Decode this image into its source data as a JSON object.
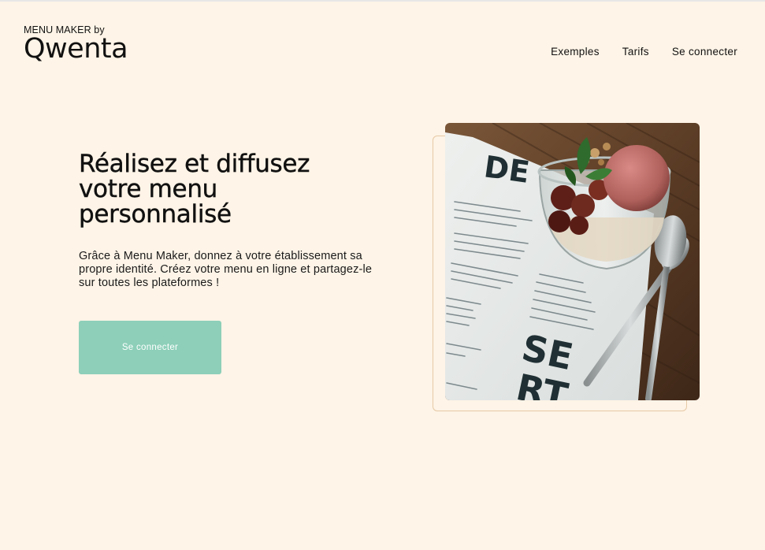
{
  "brand": {
    "tagline": "MENU MAKER by",
    "name": "Qwenta"
  },
  "nav": {
    "items": [
      {
        "label": "Exemples"
      },
      {
        "label": "Tarifs"
      },
      {
        "label": "Se connecter"
      }
    ]
  },
  "hero": {
    "title": "Réalisez et diffusez votre menu personnalisé",
    "description": "Grâce à Menu Maker, donnez à votre établissement sa propre identité. Créez votre menu en ligne et partagez-le sur toutes les plateformes !",
    "cta_label": "Se connecter"
  },
  "photo": {
    "menu_heading_top": "DE",
    "menu_heading_bottom_1": "SE",
    "menu_heading_bottom_2": "RT"
  },
  "colors": {
    "background": "#fef4e7",
    "accent": "#8dcfb9",
    "frame": "#e6c9a6",
    "text": "#111111"
  }
}
